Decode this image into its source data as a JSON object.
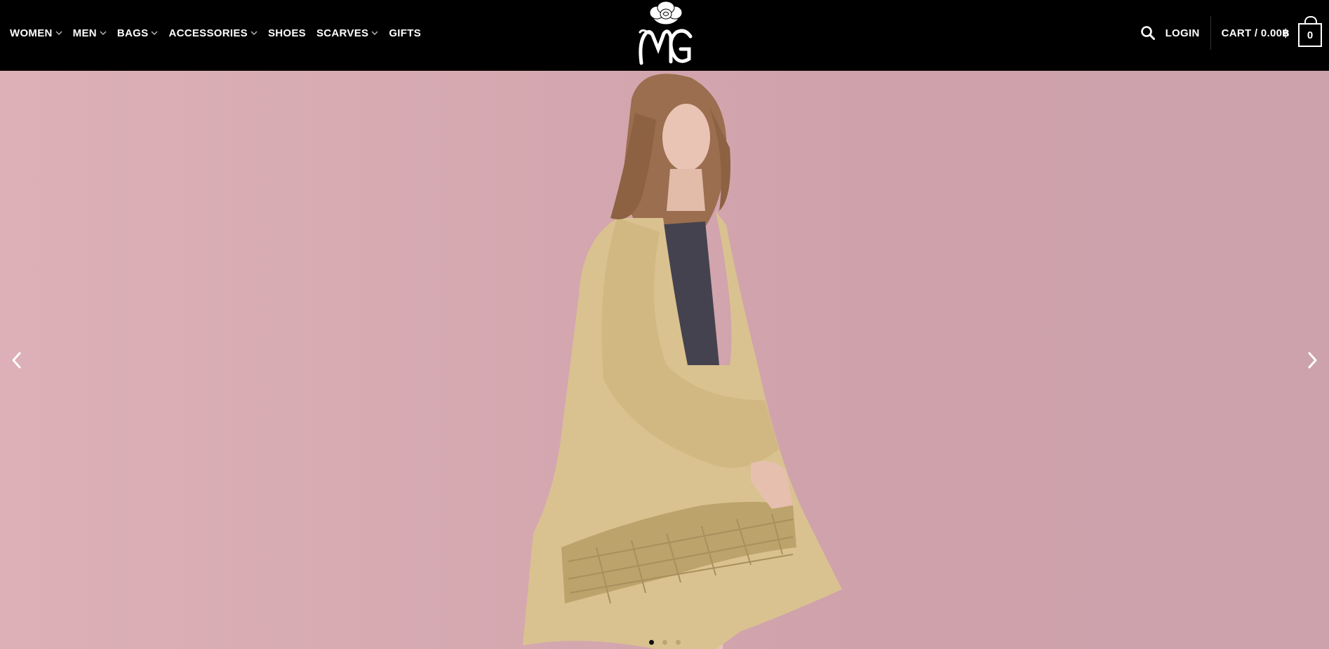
{
  "nav": {
    "items": [
      {
        "label": "WOMEN",
        "has_dropdown": true
      },
      {
        "label": "MEN",
        "has_dropdown": true
      },
      {
        "label": "BAGS",
        "has_dropdown": true
      },
      {
        "label": "ACCESSORIES",
        "has_dropdown": true
      },
      {
        "label": "SHOES",
        "has_dropdown": false
      },
      {
        "label": "SCARVES",
        "has_dropdown": true
      },
      {
        "label": "GIFTS",
        "has_dropdown": false
      }
    ]
  },
  "logo": {
    "icon": "rose-mg-monogram-logo"
  },
  "account": {
    "search_icon": "search-icon",
    "login_label": "LOGIN",
    "cart_label": "CART / 0.00฿",
    "cart_count": "0"
  },
  "slider": {
    "prev_icon": "chevron-left-icon",
    "next_icon": "chevron-right-icon",
    "slide_count": 3,
    "active_slide": 1
  },
  "colors": {
    "header_bg": "#000000",
    "hero_bg": "#d8abb3",
    "garment": "#d9c28f"
  }
}
